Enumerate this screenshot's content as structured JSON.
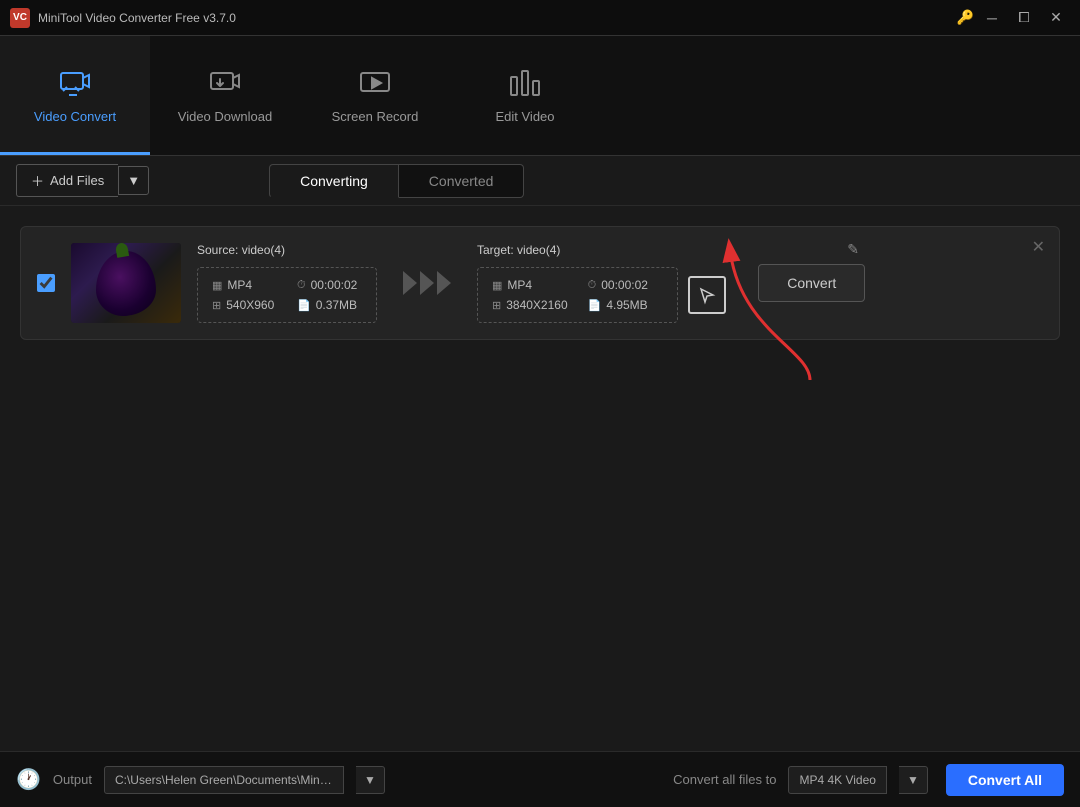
{
  "app": {
    "title": "MiniTool Video Converter Free v3.7.0",
    "logo_text": "VC"
  },
  "titlebar": {
    "key_icon": "🔑",
    "minimize_label": "─",
    "restore_label": "⧠",
    "close_label": "✕"
  },
  "nav": {
    "items": [
      {
        "id": "video-convert",
        "label": "Video Convert",
        "active": true
      },
      {
        "id": "video-download",
        "label": "Video Download",
        "active": false
      },
      {
        "id": "screen-record",
        "label": "Screen Record",
        "active": false
      },
      {
        "id": "edit-video",
        "label": "Edit Video",
        "active": false
      }
    ]
  },
  "toolbar": {
    "add_files_label": "Add Files",
    "converting_tab": "Converting",
    "converted_tab": "Converted"
  },
  "file_card": {
    "source_label": "Source:",
    "source_count": "video(4)",
    "source_format": "MP4",
    "source_duration": "00:00:02",
    "source_resolution": "540X960",
    "source_size": "0.37MB",
    "target_label": "Target:",
    "target_count": "video(4)",
    "target_format": "MP4",
    "target_duration": "00:00:02",
    "target_resolution": "3840X2160",
    "target_size": "4.95MB",
    "convert_btn_label": "Convert"
  },
  "bottombar": {
    "output_label": "Output",
    "output_path": "C:\\Users\\Helen Green\\Documents\\MiniTool Video Converter\\c...",
    "convert_all_files_label": "Convert all files to",
    "convert_format": "MP4 4K Video",
    "convert_all_btn": "Convert All"
  }
}
